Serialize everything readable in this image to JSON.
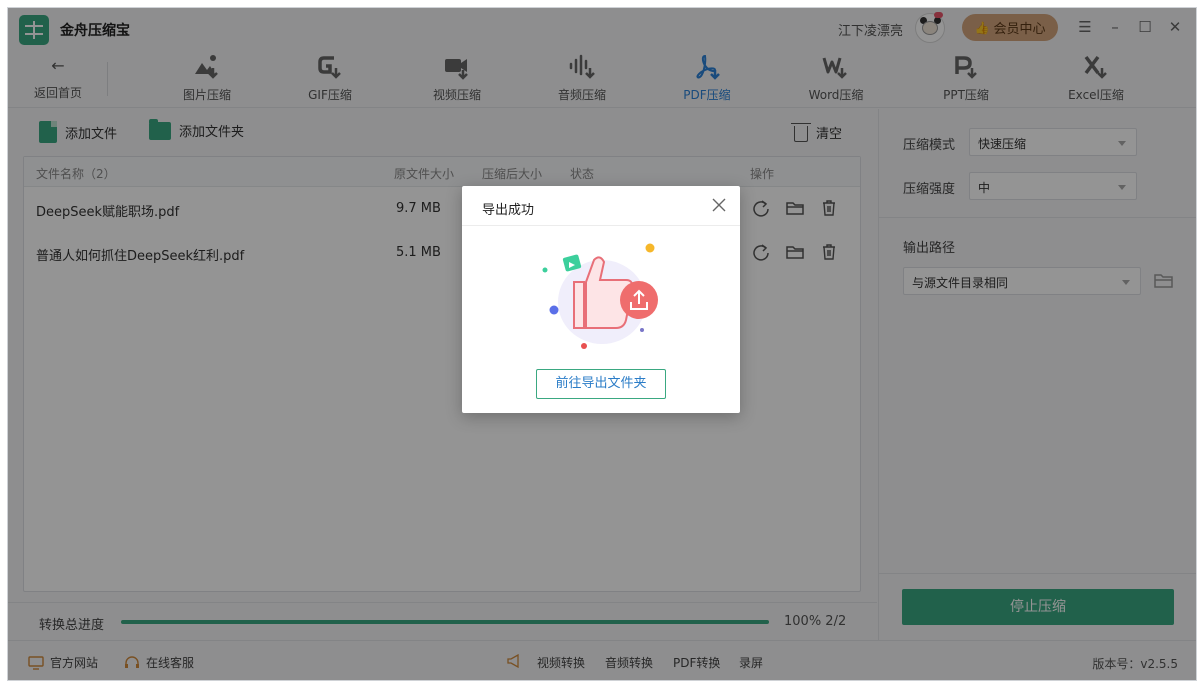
{
  "app": {
    "title": "金舟压缩宝",
    "username": "江下凌漂亮",
    "vip_label": "会员中心"
  },
  "window_controls": {
    "menu": "☰",
    "minimize": "–",
    "maximize": "☐",
    "close": "✕"
  },
  "toolbar": {
    "back_label": "返回首页",
    "tabs": [
      {
        "label": "图片压缩",
        "icon": "image-compress-icon"
      },
      {
        "label": "GIF压缩",
        "icon": "gif-compress-icon"
      },
      {
        "label": "视频压缩",
        "icon": "video-compress-icon"
      },
      {
        "label": "音频压缩",
        "icon": "audio-compress-icon"
      },
      {
        "label": "PDF压缩",
        "icon": "pdf-compress-icon",
        "active": true
      },
      {
        "label": "Word压缩",
        "icon": "word-compress-icon"
      },
      {
        "label": "PPT压缩",
        "icon": "ppt-compress-icon"
      },
      {
        "label": "Excel压缩",
        "icon": "excel-compress-icon"
      }
    ]
  },
  "actions": {
    "add_file": "添加文件",
    "add_folder": "添加文件夹",
    "clear": "清空"
  },
  "table": {
    "headers": {
      "name": "文件名称（2）",
      "original_size": "原文件大小",
      "compressed_size": "压缩后大小",
      "status": "状态",
      "ops": "操作"
    },
    "rows": [
      {
        "name": "DeepSeek赋能职场.pdf",
        "original_size": "9.7 MB"
      },
      {
        "name": "普通人如何抓住DeepSeek红利.pdf",
        "original_size": "5.1 MB"
      }
    ]
  },
  "progress": {
    "label": "转换总进度",
    "value": 100,
    "text": "100% 2/2"
  },
  "settings": {
    "mode_label": "压缩模式",
    "mode_value": "快速压缩",
    "strength_label": "压缩强度",
    "strength_value": "中",
    "output_label": "输出路径",
    "output_value": "与源文件目录相同",
    "stop_button": "停止压缩"
  },
  "statusbar": {
    "website": "官方网站",
    "support": "在线客服",
    "links": [
      "视频转换",
      "音频转换",
      "PDF转换",
      "录屏"
    ],
    "version": "版本号：v2.5.5"
  },
  "dialog": {
    "title": "导出成功",
    "button": "前往导出文件夹"
  },
  "colors": {
    "accent": "#3aa881",
    "active_tab": "#2c82d8",
    "vip": "#d2a47c"
  }
}
